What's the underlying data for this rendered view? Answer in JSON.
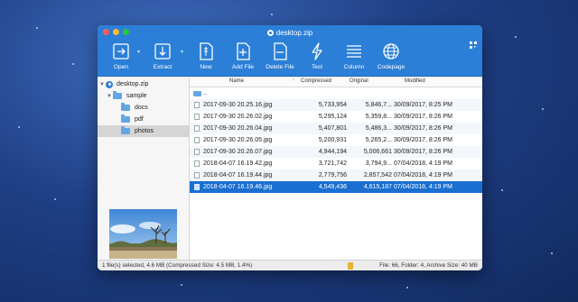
{
  "window": {
    "title": "desktop.zip"
  },
  "toolbar": {
    "buttons": [
      {
        "label": "Open",
        "icon": "open-icon"
      },
      {
        "label": "Extract",
        "icon": "extract-icon"
      },
      {
        "label": "New",
        "icon": "new-icon"
      },
      {
        "label": "Add File",
        "icon": "add-file-icon"
      },
      {
        "label": "Delete File",
        "icon": "delete-file-icon"
      },
      {
        "label": "Test",
        "icon": "test-icon"
      },
      {
        "label": "Column",
        "icon": "column-icon"
      },
      {
        "label": "Codepage",
        "icon": "codepage-icon"
      }
    ]
  },
  "sidebar": {
    "root": "desktop.zip",
    "folder": "sample",
    "children": [
      "docs",
      "pdf",
      "photos"
    ],
    "selected": "photos"
  },
  "table": {
    "headers": {
      "name": "Name",
      "compressed": "Compressed",
      "original": "Original",
      "modified": "Modified"
    },
    "parent": "..",
    "rows": [
      {
        "name": "2017-09-30 20.25.16.jpg",
        "compressed": "5,733,954",
        "original": "5,846,7...",
        "modified": "30/09/2017, 8:25 PM"
      },
      {
        "name": "2017-09-30 20.26.02.jpg",
        "compressed": "5,295,124",
        "original": "5,359,8...",
        "modified": "30/09/2017, 8:26 PM"
      },
      {
        "name": "2017-09-30 20.26.04.jpg",
        "compressed": "5,407,801",
        "original": "5,486,3...",
        "modified": "30/09/2017, 8:26 PM"
      },
      {
        "name": "2017-09-30 20.26.05.jpg",
        "compressed": "5,200,931",
        "original": "5,265,2...",
        "modified": "30/09/2017, 8:26 PM"
      },
      {
        "name": "2017-09-30 20.26.07.jpg",
        "compressed": "4,944,194",
        "original": "5,006,661",
        "modified": "30/09/2017, 8:26 PM"
      },
      {
        "name": "2018-04-07 16.19.42.jpg",
        "compressed": "3,721,742",
        "original": "3,794,9...",
        "modified": "07/04/2018, 4:19 PM"
      },
      {
        "name": "2018-04-07 16.19.44.jpg",
        "compressed": "2,779,756",
        "original": "2,857,542",
        "modified": "07/04/2018, 4:19 PM"
      },
      {
        "name": "2018-04-07 16.19.46.jpg",
        "compressed": "4,549,436",
        "original": "4,615,187",
        "modified": "07/04/2018, 4:19 PM"
      }
    ],
    "selected_index": 7
  },
  "status": {
    "left": "1 file(s) selected, 4.6 MB (Compressed Size: 4.5 MB, 1.4%)",
    "right": "File: 66, Folder: 4, Archive Size: 40 MB"
  },
  "colors": {
    "accent": "#2b7fd7",
    "selection": "#1a6fd1"
  }
}
